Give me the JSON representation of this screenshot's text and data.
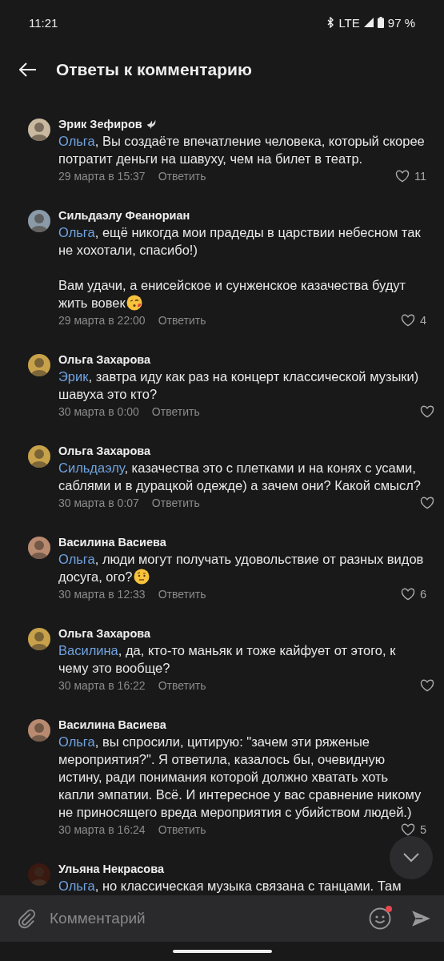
{
  "status_bar": {
    "time": "11:21",
    "network": "LTE",
    "battery": "97 %"
  },
  "header": {
    "title": "Ответы к комментарию"
  },
  "comments": [
    {
      "author": "Эрик Зефиров",
      "dove_badge": true,
      "mention": "Ольга",
      "text": ", Вы создаёте впечатление человека, который скорее потратит деньги на шавуху, чем на билет в театр.",
      "date": "29 марта в 15:37",
      "reply": "Ответить",
      "likes": "11"
    },
    {
      "author": "Сильдаэлу Феанориан",
      "mention": "Ольга",
      "text": ", ещё никогда мои прадеды в царствии небесном так не хохотали, спасибо!)\n\nВам удачи, а енисейское и сунженское казачества будут жить вовек",
      "kiss_emoji": true,
      "date": "29 марта в 22:00",
      "reply": "Ответить",
      "likes": "4"
    },
    {
      "author": "Ольга Захарова",
      "mention": "Эрик",
      "text": ", завтра иду как раз на концерт классической музыки) шавуха это кто?",
      "date": "30 марта в 0:00",
      "reply": "Ответить"
    },
    {
      "author": "Ольга Захарова",
      "mention": "Сильдаэлу",
      "text": ", казачества это с плетками и на конях с усами, саблями и в дурацкой одежде) а зачем они? Какой смысл?",
      "date": "30 марта в 0:07",
      "reply": "Ответить"
    },
    {
      "author": "Василина Васиева",
      "mention": "Ольга",
      "text": ", люди могут получать удовольствие от разных видов досуга, ого?",
      "skeptical_emoji": true,
      "date": "30 марта в 12:33",
      "reply": "Ответить",
      "likes": "6"
    },
    {
      "author": "Ольга Захарова",
      "mention": "Василина",
      "text": ", да, кто-то маньяк и тоже кайфует от этого, к чему это вообще?",
      "date": "30 марта в 16:22",
      "reply": "Ответить"
    },
    {
      "author": "Василина Васиева",
      "mention": "Ольга",
      "text": ", вы спросили, цитирую: \"зачем эти ряженые мероприятия?\". Я ответила, казалось бы, очевидную истину, ради понимания которой должно хватать хоть капли эмпатии. Всё. И интересное у вас сравнение никому не приносящего вреда мероприятия с yбийством людей.)",
      "date": "30 марта в 16:24",
      "reply": "Ответить",
      "likes": "5"
    },
    {
      "author": "Ульяна Некрасова",
      "mention": "Ольга",
      "text": ", но классическая музыка связана с танцами. Там"
    }
  ],
  "composer": {
    "placeholder": "Комментарий",
    "emoji_notification": true
  }
}
